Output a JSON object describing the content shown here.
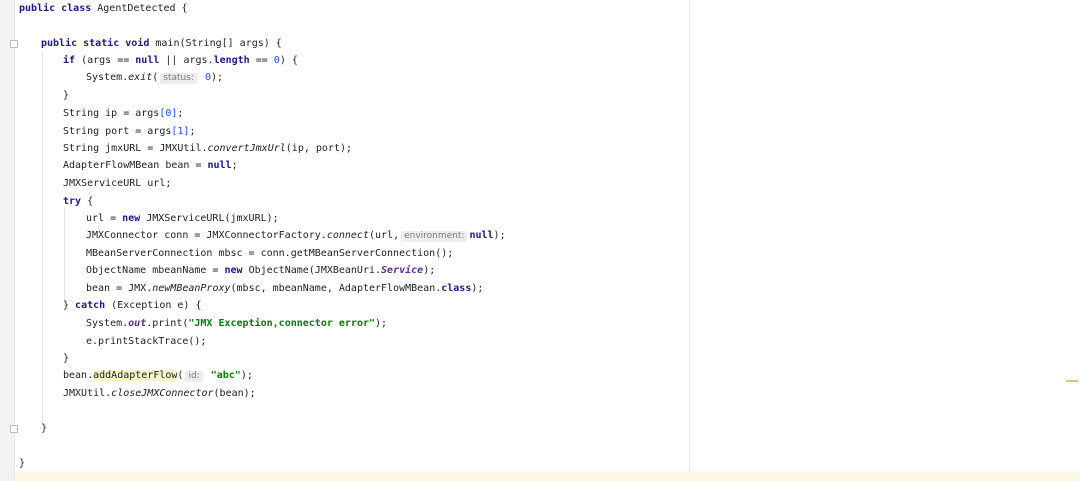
{
  "code": {
    "l1": {
      "kw1": "public class",
      "rest": " AgentDetected {"
    },
    "l2": {
      "kw1": "public static void",
      "rest": " main(String[] args) {"
    },
    "l3": {
      "kw1": "if",
      "a": " (args ",
      "op": "==",
      "b": " ",
      "kw2": "null",
      "c": " || args.",
      "kw3": "length",
      "d": " ",
      "op2": "==",
      "num": " 0",
      ") ": ") {"
    },
    "l4": {
      "a": "System.",
      "m": "exit",
      "b": "(",
      "hint": "status:",
      "num": " 0",
      "c": ");"
    },
    "l5": {
      "a": "}"
    },
    "l6": {
      "a": "String ip = args",
      "num": "[0]",
      "b": ";"
    },
    "l7": {
      "a": "String port = args",
      "num": "[1]",
      "b": ";"
    },
    "l8": {
      "a": "String jmxURL = JMXUtil.",
      "m": "convertJmxUrl",
      "b": "(ip, port);"
    },
    "l9": {
      "a": "AdapterFlowMBean bean = ",
      "kw": "null",
      "b": ";"
    },
    "l10": {
      "a": "JMXServiceURL url;"
    },
    "l11": {
      "kw": "try",
      "a": " {"
    },
    "l12": {
      "a": "url = ",
      "kw": "new",
      "b": " JMXServiceURL(jmxURL);"
    },
    "l13": {
      "a": "JMXConnector conn = JMXConnectorFactory.",
      "m": "connect",
      "b": "(url,",
      "hint": "environment:",
      "kw": "null",
      "c": ");"
    },
    "l14": {
      "a": "MBeanServerConnection mbsc = conn.getMBeanServerConnection();"
    },
    "l15": {
      "a": "ObjectName mbeanName = ",
      "kw": "new",
      "b": " ObjectName(JMXBeanUri.",
      "f": "Service",
      "c": ");"
    },
    "l16": {
      "a": "bean = JMX.",
      "m": "newMBeanProxy",
      "b": "(mbsc, mbeanName, AdapterFlowMBean.",
      "kw": "class",
      "c": ");"
    },
    "l17": {
      "a": "} ",
      "kw": "catch",
      "b": " (Exception e) {"
    },
    "l18": {
      "a": "System.",
      "f": "out",
      "b": ".print(",
      "s": "\"JMX Exception,connector error\"",
      "c": ");"
    },
    "l19": {
      "a": "e.printStackTrace();"
    },
    "l20": {
      "a": "}"
    },
    "l21": {
      "a": "bean.",
      "m": "addAdapterFlow",
      "b": "(",
      "hint": "id:",
      "s": " \"abc\"",
      "c": ");"
    },
    "l22": {
      "a": "JMXUtil.",
      "m": "closeJMXConnector",
      "b": "(bean);"
    },
    "l23": {
      "a": "}"
    },
    "l24": {
      "a": "}"
    }
  }
}
